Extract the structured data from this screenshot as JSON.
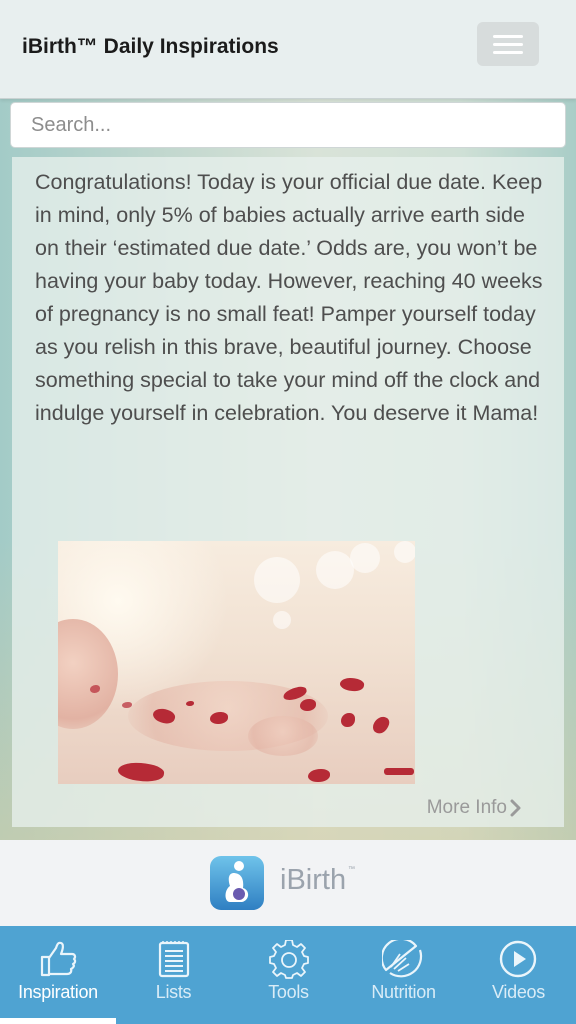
{
  "header": {
    "title": "iBirth™ Daily Inspirations",
    "menu_icon": "hamburger-menu-icon"
  },
  "search": {
    "placeholder": "Search..."
  },
  "inspiration": {
    "text": "Congratulations! Today is your official due date. Keep in mind, only 5% of babies actually arrive earth side on their ‘estimated due date.’ Odds are, you won’t be having your baby today. However, reaching 40 weeks of pregnancy is no small feat! Pamper yourself today as you relish in this brave, beautiful journey. Choose something special to take your mind off the clock and indulge yourself in celebration. You deserve it Mama!",
    "more_info_label": "More Info"
  },
  "brand": {
    "name": "iBirth",
    "tm": "™"
  },
  "tabs": [
    {
      "label": "Inspiration",
      "icon": "thumbs-up-icon",
      "active": true
    },
    {
      "label": "Lists",
      "icon": "list-icon",
      "active": false
    },
    {
      "label": "Tools",
      "icon": "gear-icon",
      "active": false
    },
    {
      "label": "Nutrition",
      "icon": "citrus-icon",
      "active": false
    },
    {
      "label": "Videos",
      "icon": "play-icon",
      "active": false
    }
  ],
  "colors": {
    "tab_bar": "#4fa3d2",
    "header_bg": "#e8efef"
  }
}
